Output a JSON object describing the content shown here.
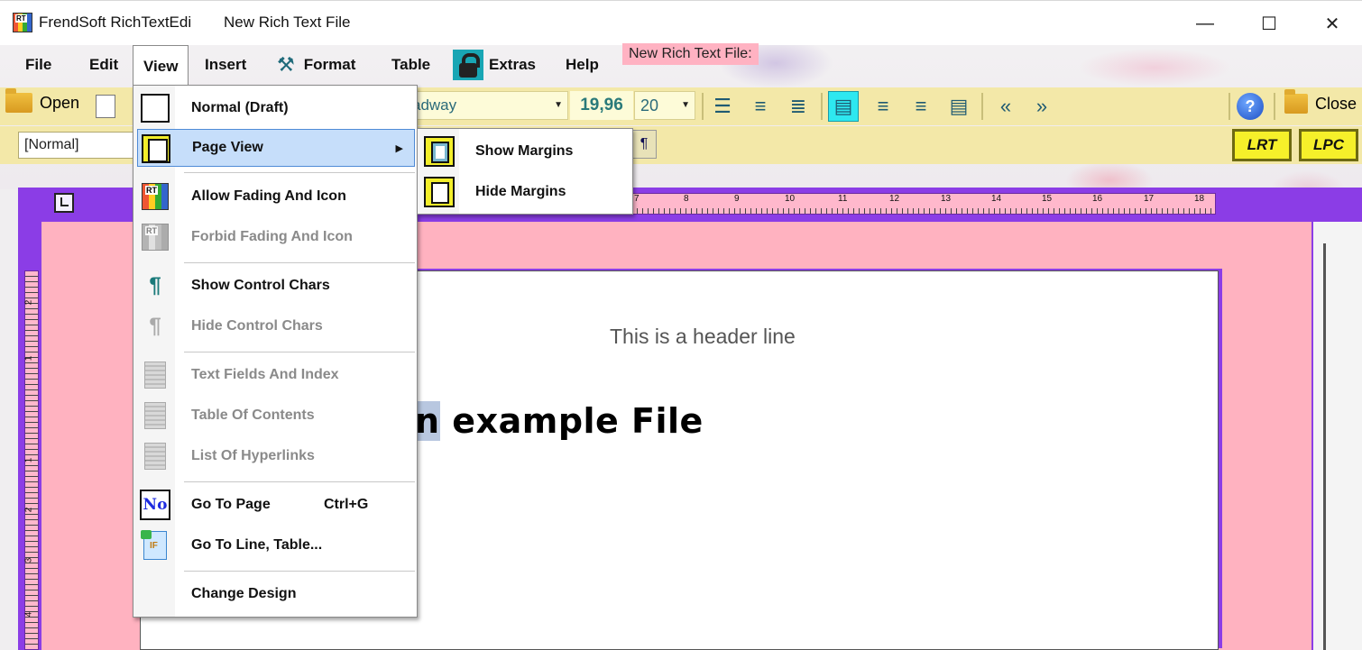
{
  "window": {
    "app_title": "FrendSoft RichTextEdi",
    "doc_title": "New Rich Text File",
    "minimize": "—",
    "maximize": "☐",
    "close": "✕"
  },
  "menubar": {
    "items": [
      "File",
      "Edit",
      "View",
      "Insert",
      "Format",
      "Table",
      "Extras",
      "Help"
    ],
    "open_menu": "View",
    "doc_tag": "New Rich Text File:"
  },
  "toolbar": {
    "open_label": "Open",
    "font_name": "adway",
    "font_size_exact": "19,96",
    "font_size": "20",
    "close_label": "Close",
    "style_value": "[Normal]",
    "pilcrow": "¶",
    "lrt_label": "LRT",
    "lpc_label": "LPC",
    "active_align": "align-left",
    "accent_color": "#2ee8f0"
  },
  "ruler": {
    "top_ticks": [
      "7",
      "8",
      "9",
      "10",
      "11",
      "12",
      "13",
      "14",
      "15",
      "16",
      "17",
      "18"
    ],
    "left_ticks": [
      "2",
      "1",
      "1",
      "2",
      "3",
      "4"
    ]
  },
  "document": {
    "header_line": "This is a header line",
    "example_selected": "n",
    "example_rest": " example File"
  },
  "view_menu": {
    "items": [
      {
        "label": "Normal (Draft)",
        "icon": "blank-page-icon",
        "enabled": true
      },
      {
        "label": "Page View",
        "icon": "page-view-icon",
        "enabled": true,
        "highlighted": true,
        "submenu": true
      },
      {
        "label": "Allow Fading And Icon",
        "icon": "rt-logo-icon",
        "enabled": true
      },
      {
        "label": "Forbid Fading And Icon",
        "icon": "rt-logo-gray-icon",
        "enabled": false
      },
      {
        "label": "Show Control Chars",
        "icon": "pilcrow-icon",
        "enabled": true
      },
      {
        "label": "Hide Control Chars",
        "icon": "pilcrow-gray-icon",
        "enabled": false
      },
      {
        "label": "Text Fields And Index",
        "icon": "document-icon",
        "enabled": false
      },
      {
        "label": "Table Of Contents",
        "icon": "document-icon",
        "enabled": false
      },
      {
        "label": "List Of Hyperlinks",
        "icon": "document-icon",
        "enabled": false
      },
      {
        "label": "Go To Page",
        "icon": "number-icon",
        "enabled": true,
        "shortcut": "Ctrl+G"
      },
      {
        "label": "Go To Line, Table...",
        "icon": "goto-icon",
        "enabled": true
      },
      {
        "label": "Change Design",
        "icon": "",
        "enabled": true
      }
    ],
    "number_icon_text": "No"
  },
  "page_view_submenu": {
    "items": [
      "Show Margins",
      "Hide Margins"
    ]
  },
  "colors": {
    "toolbar_bg": "#f3e8a8",
    "editor_frame": "#8b3de6",
    "pink_area": "#ffb2c0",
    "menu_highlight": "#c6defa"
  }
}
